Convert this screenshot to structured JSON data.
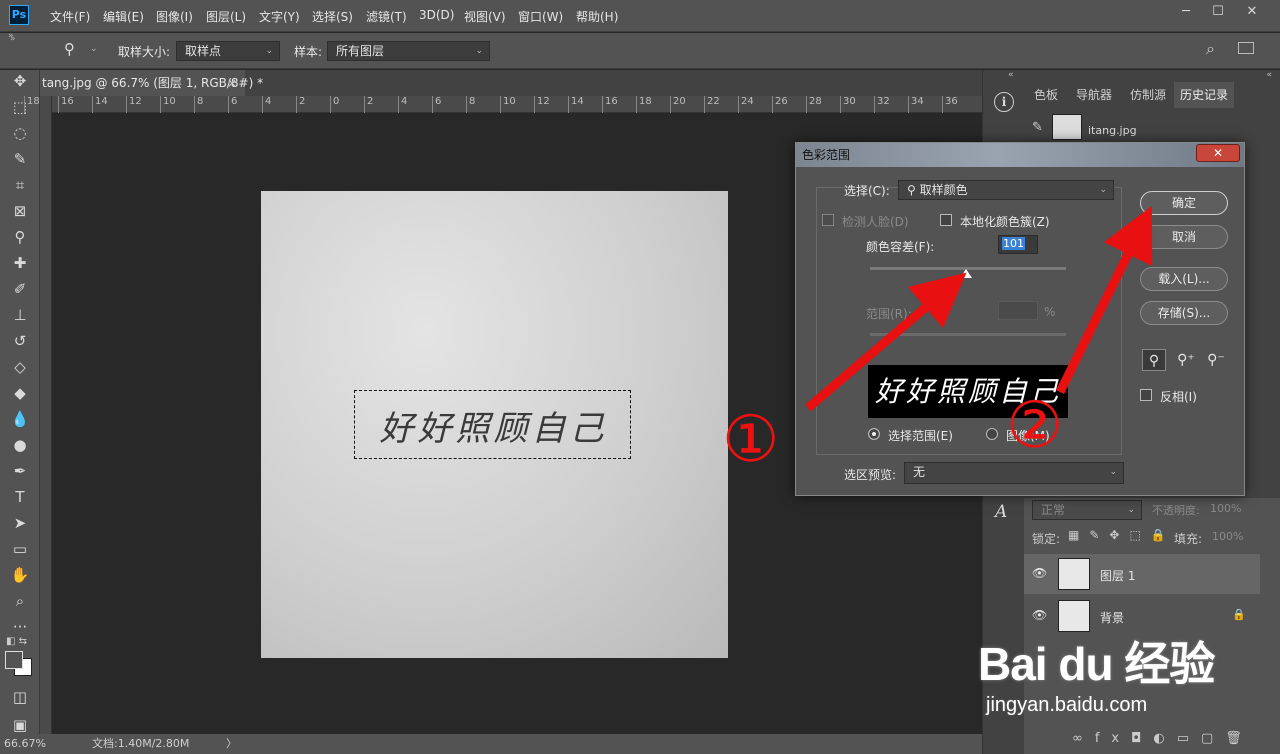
{
  "app": {
    "logo": "Ps"
  },
  "menu": [
    "文件(F)",
    "编辑(E)",
    "图像(I)",
    "图层(L)",
    "文字(Y)",
    "选择(S)",
    "滤镜(T)",
    "3D(D)",
    "视图(V)",
    "窗口(W)",
    "帮助(H)"
  ],
  "window_controls": {
    "minimize": "─",
    "maximize": "☐",
    "close": "✕"
  },
  "options": {
    "sample_size_label": "取样大小:",
    "sample_size_value": "取样点",
    "sample_label": "样本:",
    "sample_value": "所有图层"
  },
  "document": {
    "tab_title": "tang.jpg @ 66.7% (图层 1, RGB/8#) *",
    "close": "×"
  },
  "ruler_ticks": [
    "18",
    "16",
    "14",
    "12",
    "10",
    "8",
    "6",
    "4",
    "2",
    "0",
    "2",
    "4",
    "6",
    "8",
    "10",
    "12",
    "14",
    "16",
    "18",
    "20",
    "22",
    "24",
    "26",
    "28",
    "30",
    "32",
    "34",
    "36"
  ],
  "canvas": {
    "handwriting": "好好照顾自己"
  },
  "status": {
    "zoom": "66.67%",
    "doc": "文档:1.40M/2.80M",
    "arrow": "〉"
  },
  "panels": {
    "tabs": [
      "色板",
      "导航器",
      "仿制源",
      "历史记录"
    ],
    "active_tab": "历史记录",
    "history_item": "itang.jpg"
  },
  "layers": {
    "blend_mode": "正常",
    "opacity_label": "不透明度:",
    "opacity_value": "100%",
    "lock_label": "锁定:",
    "fill_label": "填充:",
    "fill_value": "100%",
    "items": [
      {
        "name": "图层 1",
        "selected": true
      },
      {
        "name": "背景",
        "locked": true
      }
    ]
  },
  "dialog": {
    "title": "色彩范围",
    "close": "✕",
    "select_label": "选择(C):",
    "select_value": "取样颜色",
    "detect_faces": "检测人脸(D)",
    "localized": "本地化颜色簇(Z)",
    "fuzziness_label": "颜色容差(F):",
    "fuzziness_value": "101",
    "fuzziness_fraction": 0.49,
    "range_label": "范围(R):",
    "range_unit": "%",
    "preview_text": "好好照顾自己",
    "radio_selection": "选择范围(E)",
    "radio_image": "图像(M)",
    "selection_preview_label": "选区预览:",
    "selection_preview_value": "无",
    "buttons": {
      "ok": "确定",
      "cancel": "取消",
      "load": "载入(L)...",
      "save": "存储(S)..."
    },
    "invert": "反相(I)"
  },
  "annotations": {
    "one": "①",
    "two": "②",
    "color": "#e81010"
  },
  "watermark": {
    "logo": "Bai du 经验",
    "url": "jingyan.baidu.com"
  }
}
